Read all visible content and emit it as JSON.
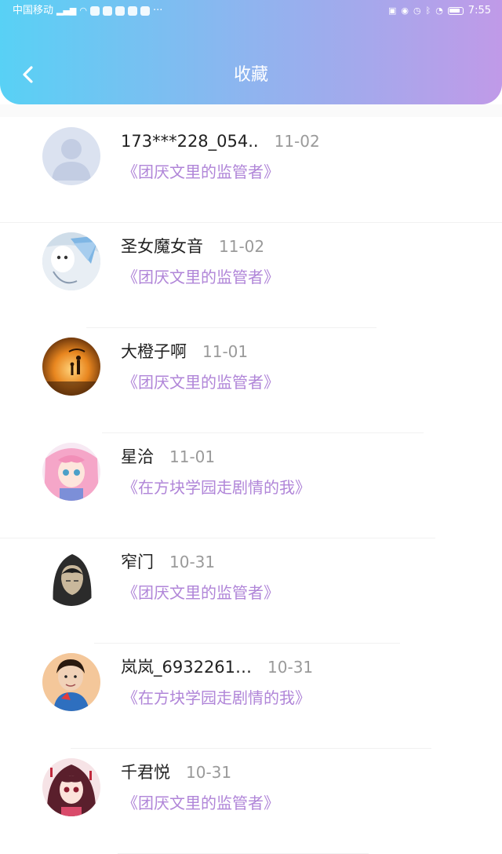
{
  "status_bar": {
    "carrier": "中国移动",
    "signal_label": "4G",
    "time": "7:55",
    "more": "···"
  },
  "header": {
    "title": "收藏"
  },
  "favorites": [
    {
      "name": "173***228_054..",
      "date": "11-02",
      "book": "《团厌文里的监管者》",
      "avatar": "default-avatar"
    },
    {
      "name": "圣女魔女音",
      "date": "11-02",
      "book": "《团厌文里的监管者》",
      "avatar": "white-wolf-avatar"
    },
    {
      "name": "大橙子啊",
      "date": "11-01",
      "book": "《团厌文里的监管者》",
      "avatar": "sunset-silhouette-avatar"
    },
    {
      "name": "星洽",
      "date": "11-01",
      "book": "《在方块学园走剧情的我》",
      "avatar": "anime-girl-pink-avatar"
    },
    {
      "name": "窄门",
      "date": "10-31",
      "book": "《团厌文里的监管者》",
      "avatar": "hooded-figure-avatar"
    },
    {
      "name": "岚岚_6932261…",
      "date": "10-31",
      "book": "《在方块学园走剧情的我》",
      "avatar": "child-photo-avatar"
    },
    {
      "name": "千君悦",
      "date": "10-31",
      "book": "《团厌文里的监管者》",
      "avatar": "anime-girl-red-avatar"
    }
  ],
  "colors": {
    "header_gradient_start": "#58d1f5",
    "header_gradient_end": "#c09ae8",
    "book_title": "#b085d8",
    "date": "#9a9a9a",
    "name": "#222222"
  }
}
